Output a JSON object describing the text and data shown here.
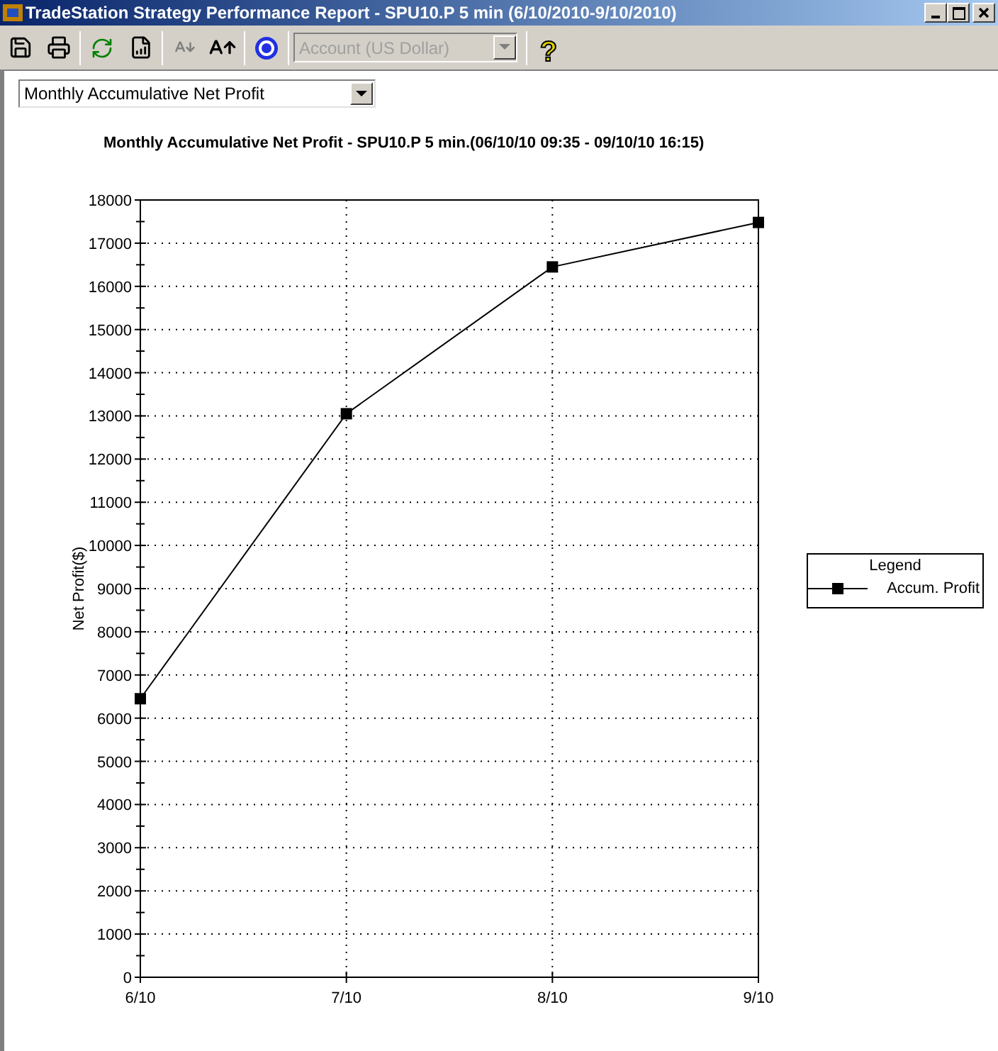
{
  "window": {
    "title": "TradeStation Strategy Performance Report - SPU10.P 5 min (6/10/2010-9/10/2010)"
  },
  "toolbar": {
    "account_select": {
      "value": "Account (US Dollar)",
      "disabled": true
    },
    "help_glyph": "?"
  },
  "report_select": {
    "value": "Monthly Accumulative Net Profit"
  },
  "chart_title": "Monthly Accumulative Net Profit - SPU10.P 5 min.(06/10/10 09:35 - 09/10/10 16:15)",
  "chart_data": {
    "type": "line",
    "grid": true,
    "ylabel": "Net Profit($)",
    "categories": [
      "6/10",
      "7/10",
      "8/10",
      "9/10"
    ],
    "ylim": [
      0,
      18000
    ],
    "yticks": [
      0,
      1000,
      2000,
      3000,
      4000,
      5000,
      6000,
      7000,
      8000,
      9000,
      10000,
      11000,
      12000,
      13000,
      14000,
      15000,
      16000,
      17000,
      18000
    ],
    "series": [
      {
        "name": "Accum. Profit",
        "color": "#000000",
        "marker": "square",
        "values": [
          6450,
          13050,
          16450,
          17480
        ]
      }
    ]
  },
  "legend": {
    "title": "Legend"
  }
}
